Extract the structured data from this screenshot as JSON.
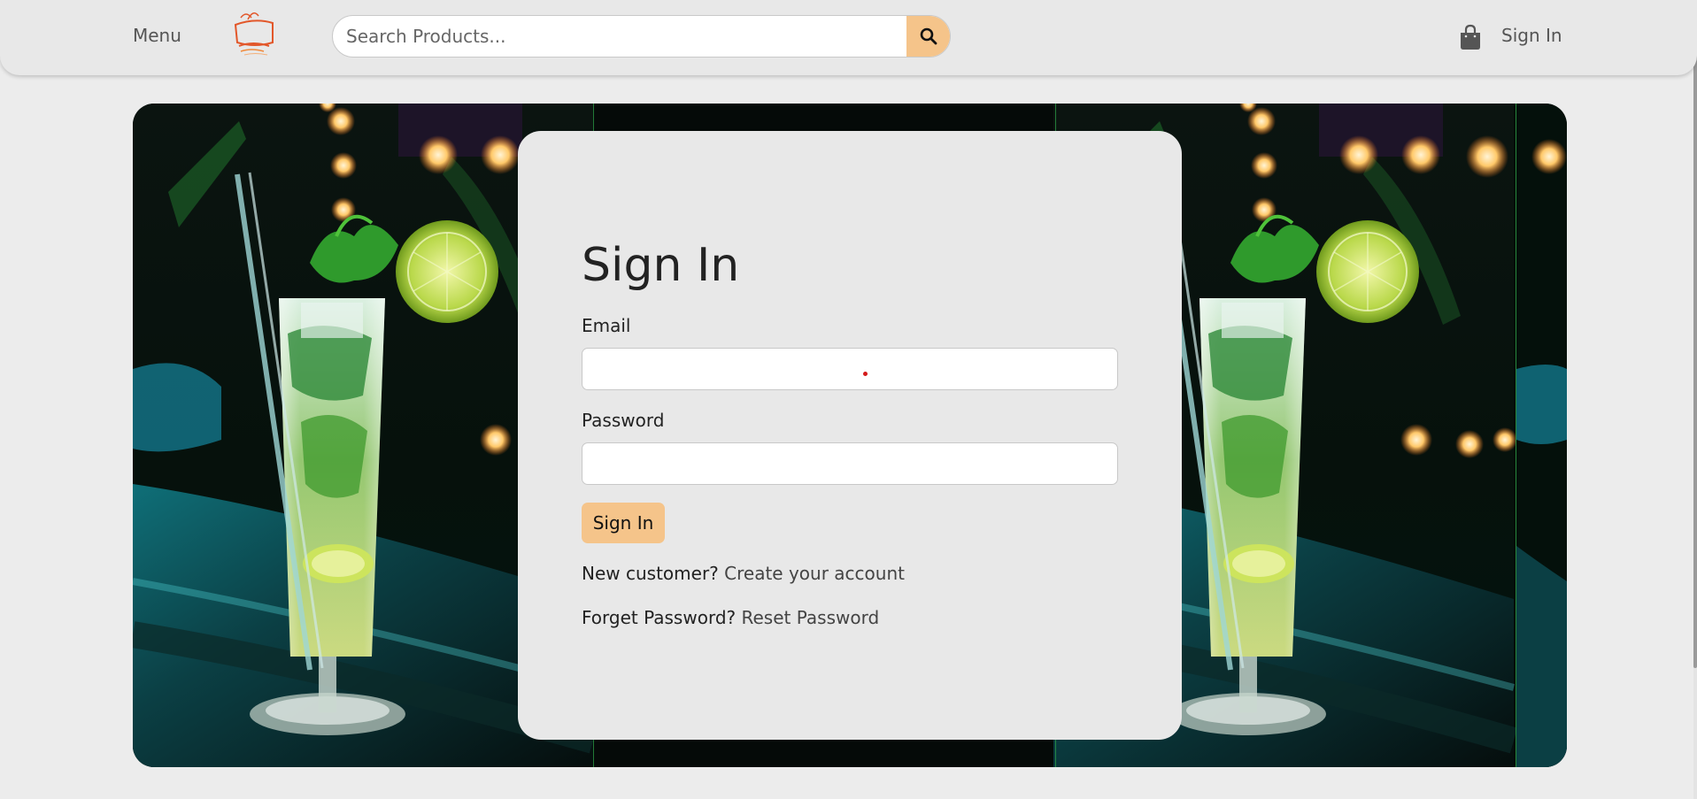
{
  "header": {
    "menu_label": "Menu",
    "logo_name": "t-house-logo",
    "search_placeholder": "Search Products...",
    "search_icon": "search-icon",
    "cart_icon": "shopping-bag-icon",
    "signin_label": "Sign In"
  },
  "hero": {
    "image_subject": "mojito-cocktail-glass"
  },
  "signin_form": {
    "title": "Sign In",
    "email_label": "Email",
    "email_value": "",
    "password_label": "Password",
    "password_value": "",
    "submit_label": "Sign In",
    "new_customer_text": "New customer?",
    "create_account_link": "Create your account",
    "forgot_password_text": "Forget Password?",
    "reset_password_link": "Reset Password"
  },
  "colors": {
    "accent": "#f5c48a",
    "background": "#ececec",
    "card": "#e8e8e8"
  }
}
